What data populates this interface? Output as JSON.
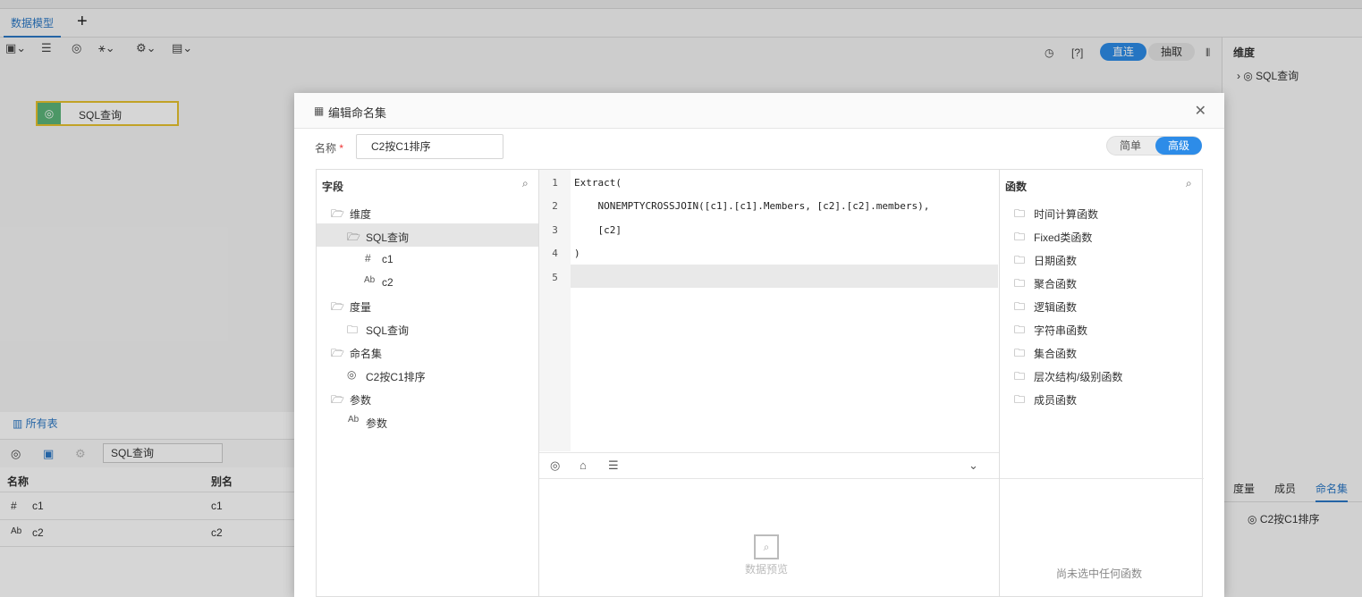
{
  "tabs": {
    "model": "数据模型",
    "add": "+"
  },
  "toolbar_right": {
    "help": "[?]",
    "direct": "直连",
    "extract": "抽取"
  },
  "canvas": {
    "node_label": "SQL查询"
  },
  "right_panel": {
    "title": "维度",
    "item": "SQL查询",
    "tabs": [
      "度量",
      "成员",
      "命名集"
    ],
    "named_item": "C2按C1排序"
  },
  "bottom": {
    "all_tables": "所有表",
    "search_value": "SQL查询",
    "columns": [
      "名称",
      "别名"
    ],
    "rows": [
      {
        "type_icon": "#",
        "name": "c1",
        "alias": "c1"
      },
      {
        "type_icon": "Ab",
        "name": "c2",
        "alias": "c2"
      }
    ]
  },
  "dialog": {
    "title": "编辑命名集",
    "name_label": "名称",
    "required_mark": "*",
    "name_value": "C2按C1排序",
    "mode_simple": "简单",
    "mode_advanced": "高级",
    "fields_title": "字段",
    "tree": [
      {
        "icon": "folder-open",
        "label": "维度",
        "indent": 1
      },
      {
        "icon": "folder-open",
        "label": "SQL查询",
        "indent": 2,
        "selected": true
      },
      {
        "icon": "#",
        "label": "c1",
        "indent": 3
      },
      {
        "icon": "Ab",
        "label": "c2",
        "indent": 3
      },
      {
        "icon": "folder-open",
        "label": "度量",
        "indent": 1
      },
      {
        "icon": "folder",
        "label": "SQL查询",
        "indent": 2
      },
      {
        "icon": "folder-open",
        "label": "命名集",
        "indent": 1
      },
      {
        "icon": "named-set",
        "label": "C2按C1排序",
        "indent": 2
      },
      {
        "icon": "folder-open",
        "label": "参数",
        "indent": 1
      },
      {
        "icon": "Ab",
        "label": "参数",
        "indent": 2
      }
    ],
    "code_lines": [
      {
        "no": "1",
        "text": "Extract("
      },
      {
        "no": "2",
        "text": "    NONEMPTYCROSSJOIN([c1].[c1].Members, [c2].[c2].members),"
      },
      {
        "no": "3",
        "text": "    [c2]"
      },
      {
        "no": "4",
        "text": ")"
      },
      {
        "no": "5",
        "text": ""
      }
    ],
    "preview_text": "数据预览",
    "functions_title": "函数",
    "functions": [
      "时间计算函数",
      "Fixed类函数",
      "日期函数",
      "聚合函数",
      "逻辑函数",
      "字符串函数",
      "集合函数",
      "层次结构/级别函数",
      "成员函数"
    ],
    "no_function_selected": "尚未选中任何函数"
  }
}
